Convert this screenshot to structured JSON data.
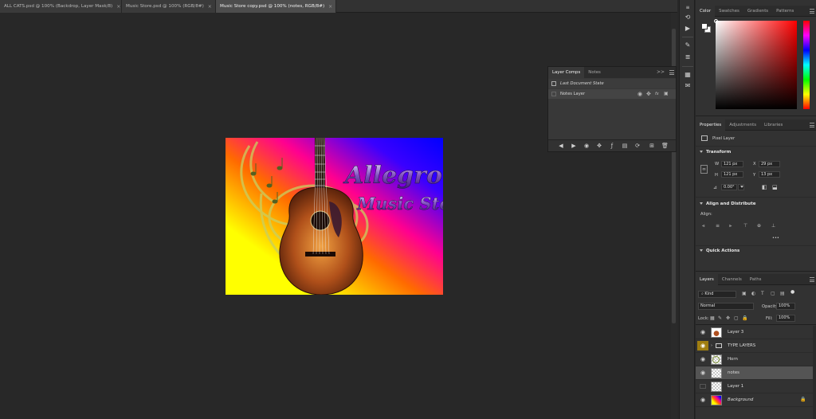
{
  "document_tabs": [
    {
      "label": "ALL CATS.psd @ 100% (Backdrop, Layer Mask/8)",
      "close": "×",
      "active": false
    },
    {
      "label": "Music Store.psd @ 100% (RGB/8#)",
      "close": "×",
      "active": false
    },
    {
      "label": "Music Store copy.psd @ 100% (notes, RGB/8#)",
      "close": "×",
      "active": true
    }
  ],
  "canvas": {
    "title_line1": "Allegro",
    "title_line2": "Music Store",
    "gradient_colors": [
      "#ffff00",
      "#ff7a00",
      "#ff0080",
      "#0000ff"
    ]
  },
  "layer_comps": {
    "tabs": [
      "Layer Comps",
      "Notes"
    ],
    "collapse_glyph": ">>",
    "items": [
      {
        "label": "Last Document State",
        "italic": true
      },
      {
        "label": "Notes Layer",
        "italic": false
      }
    ]
  },
  "color_panel": {
    "tabs": [
      "Color",
      "Swatches",
      "Gradients",
      "Patterns"
    ],
    "hue_color": "#ff0000"
  },
  "properties": {
    "tabs": [
      "Properties",
      "Adjustments",
      "Libraries"
    ],
    "kind_label": "Pixel Layer",
    "transform_title": "Transform",
    "w_label": "W",
    "w_value": "121 px",
    "h_label": "H",
    "h_value": "121 px",
    "x_label": "X",
    "x_value": "29 px",
    "y_label": "Y",
    "y_value": "13 px",
    "angle_value": "0.00°",
    "align_title": "Align and Distribute",
    "align_label": "Align:",
    "more_glyph": "•••",
    "quick_actions_title": "Quick Actions"
  },
  "layers_panel": {
    "tabs": [
      "Layers",
      "Channels",
      "Paths"
    ],
    "filter_value": "Kind",
    "blend_mode": "Normal",
    "opacity_label": "Opacity:",
    "opacity_value": "100%",
    "lock_label": "Lock:",
    "fill_label": "Fill:",
    "fill_value": "100%",
    "layers": [
      {
        "name": "Layer 3",
        "visible": true,
        "selected": false,
        "italic": false
      },
      {
        "name": "TYPE LAYERS",
        "visible": true,
        "selected": false,
        "italic": false,
        "group": true
      },
      {
        "name": "Horn",
        "visible": true,
        "selected": false,
        "italic": false
      },
      {
        "name": "notes",
        "visible": true,
        "selected": true,
        "italic": false
      },
      {
        "name": "Layer 1",
        "visible": false,
        "selected": false,
        "italic": false
      },
      {
        "name": "Background",
        "visible": true,
        "selected": false,
        "italic": true,
        "locked": true
      }
    ]
  }
}
